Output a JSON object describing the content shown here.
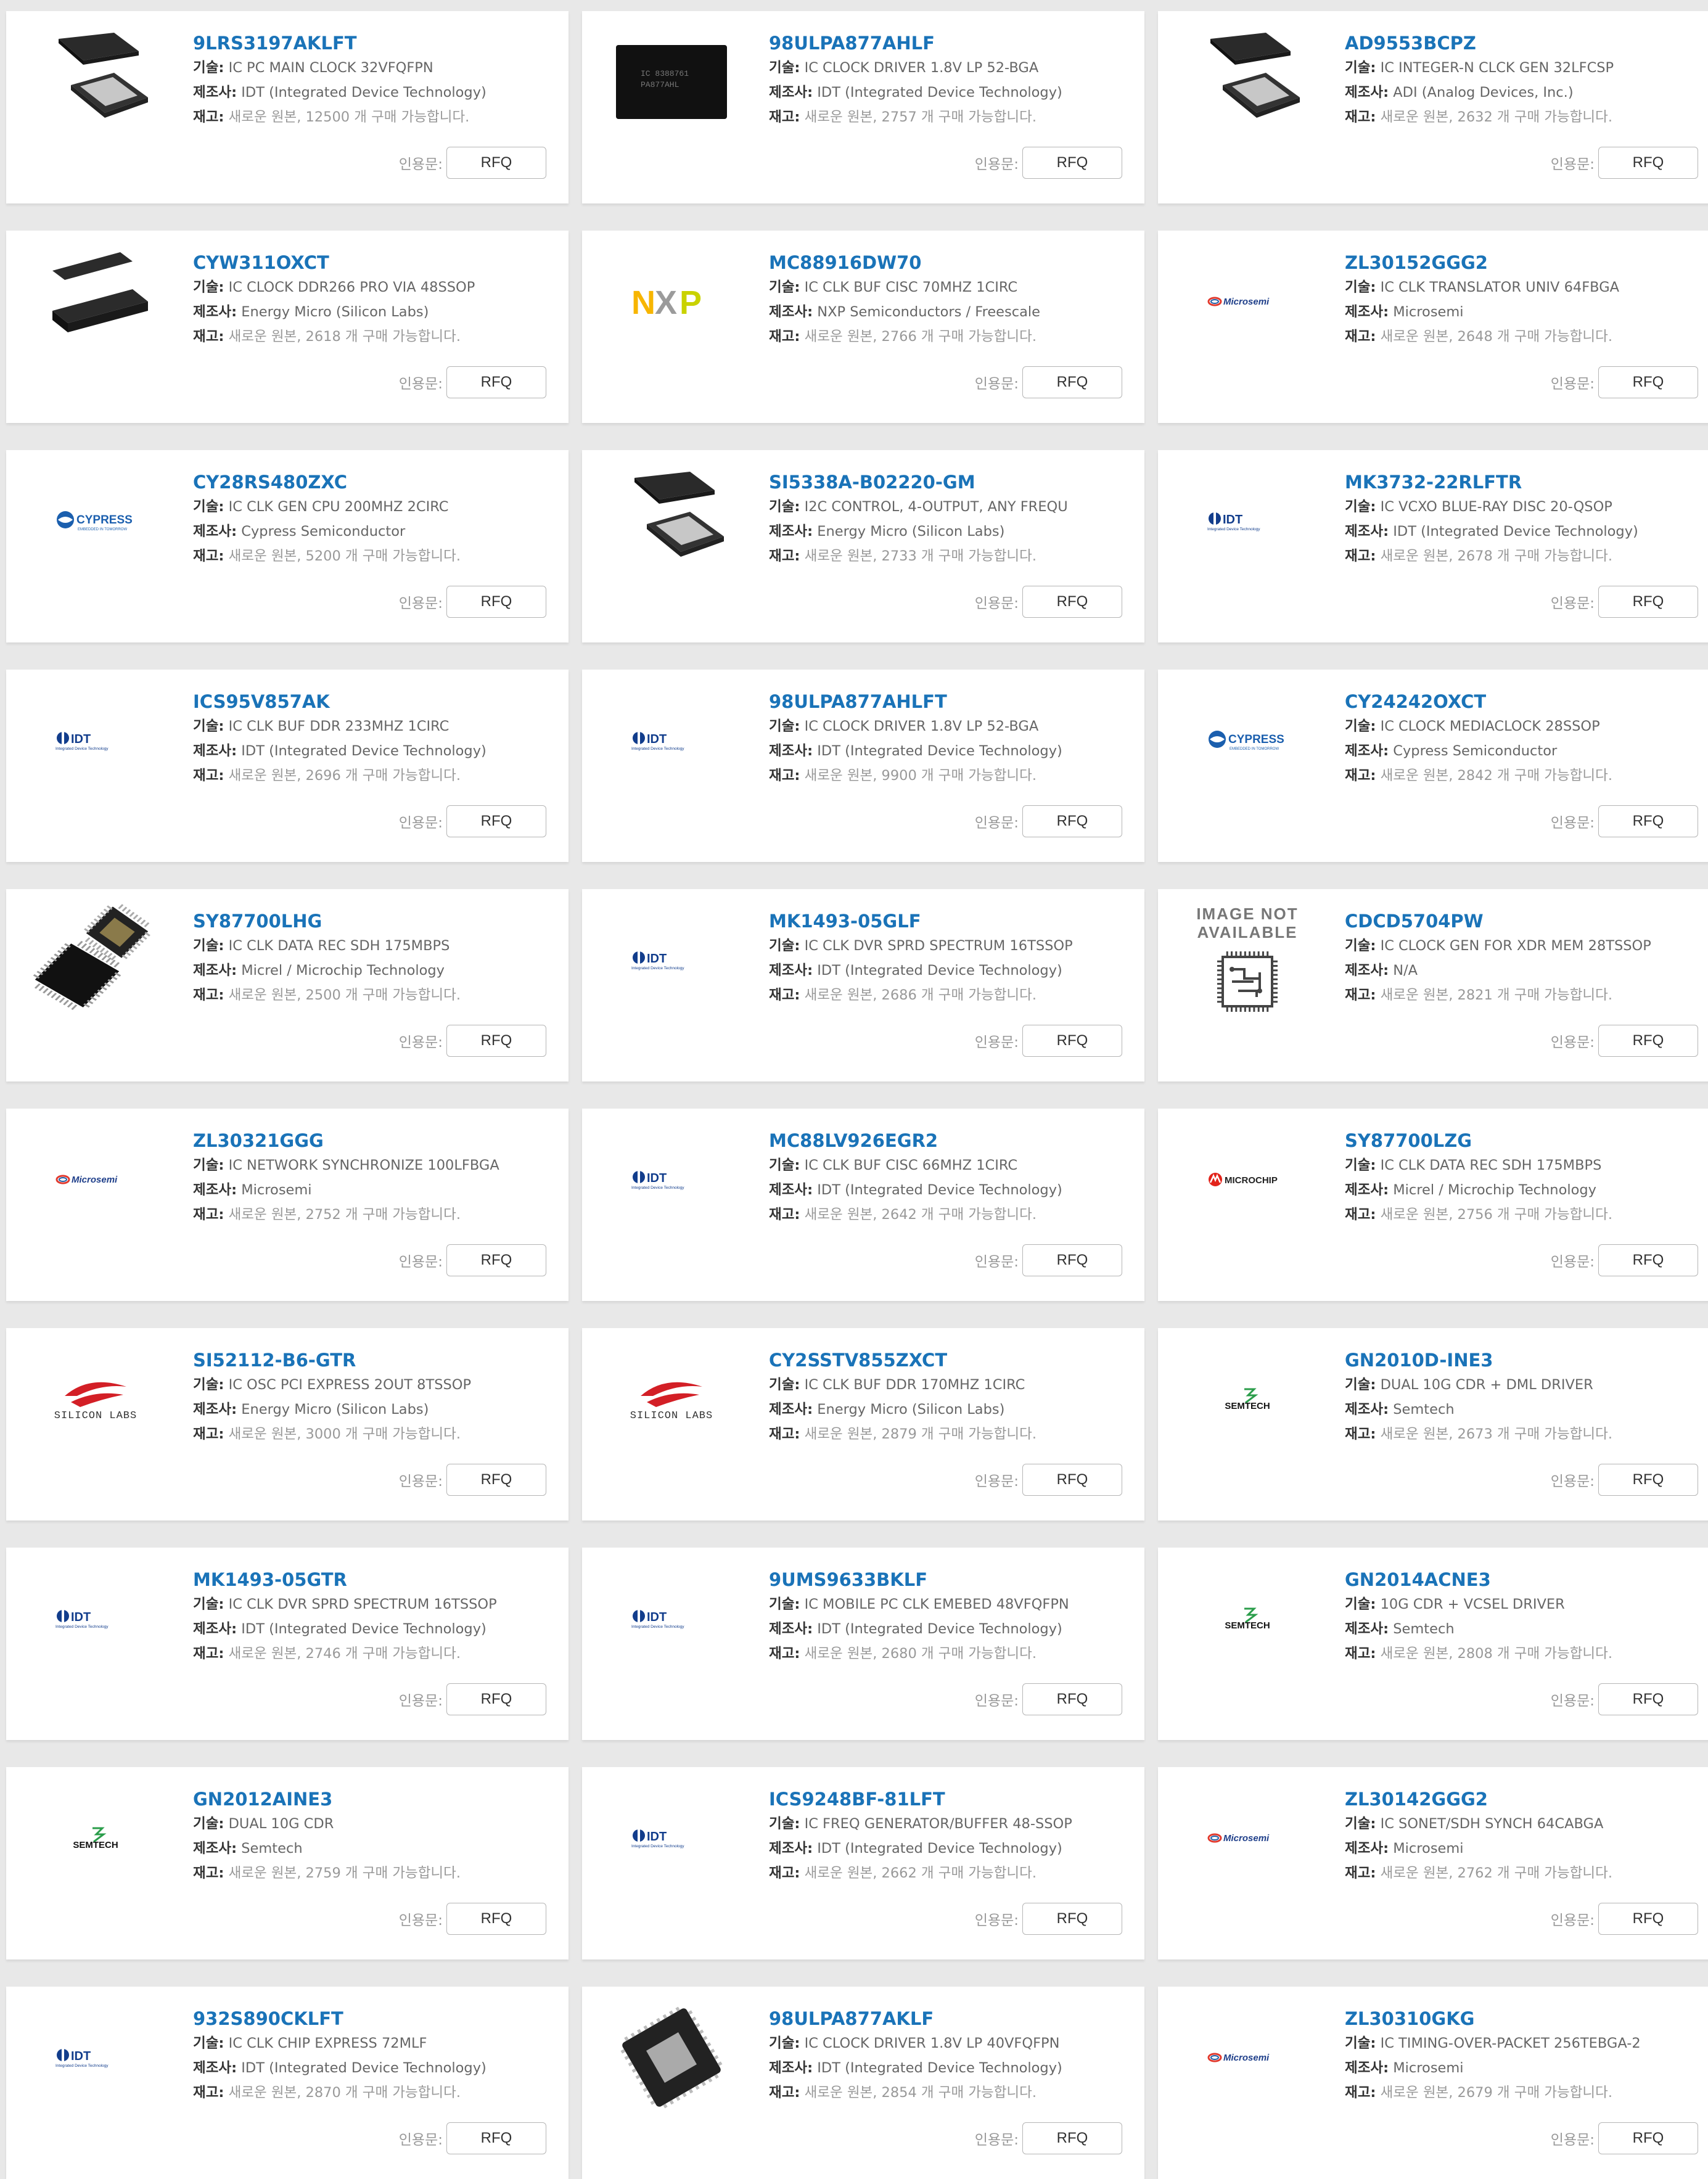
{
  "labels": {
    "tech": "기술:",
    "mfr": "제조사:",
    "stock": "재고:",
    "quote": "인용문:",
    "rfq": "RFQ",
    "image_not_available": "IMAGE NOT AVAILABLE"
  },
  "products": [
    {
      "pn": "9LRS3197AKLFT",
      "tech": "IC PC MAIN CLOCK 32VFQFPN",
      "mfr": "IDT (Integrated Device Technology)",
      "stock": "새로운 원본, 12500 개 구매 가능합니다.",
      "image": "qfn-chip"
    },
    {
      "pn": "98ULPA877AHLF",
      "tech": "IC CLOCK DRIVER 1.8V LP 52-BGA",
      "mfr": "IDT (Integrated Device Technology)",
      "stock": "새로운 원본, 2757 개 구매 가능합니다.",
      "image": "bga-chip"
    },
    {
      "pn": "AD9553BCPZ",
      "tech": "IC INTEGER-N CLCK GEN 32LFCSP",
      "mfr": "ADI (Analog Devices, Inc.)",
      "stock": "새로운 원본, 2632 개 구매 가능합니다.",
      "image": "qfn-chip"
    },
    {
      "pn": "CYW311OXCT",
      "tech": "IC CLOCK DDR266 PRO VIA 48SSOP",
      "mfr": "Energy Micro (Silicon Labs)",
      "stock": "새로운 원본, 2618 개 구매 가능합니다.",
      "image": "ssop-chip"
    },
    {
      "pn": "MC88916DW70",
      "tech": "IC CLK BUF CISC 70MHZ 1CIRC",
      "mfr": "NXP Semiconductors / Freescale",
      "stock": "새로운 원본, 2766 개 구매 가능합니다.",
      "image": "nxp-logo"
    },
    {
      "pn": "ZL30152GGG2",
      "tech": "IC CLK TRANSLATOR UNIV 64FBGA",
      "mfr": "Microsemi",
      "stock": "새로운 원본, 2648 개 구매 가능합니다.",
      "image": "microsemi-logo"
    },
    {
      "pn": "CY28RS480ZXC",
      "tech": "IC CLK GEN CPU 200MHZ 2CIRC",
      "mfr": "Cypress Semiconductor",
      "stock": "새로운 원본, 5200 개 구매 가능합니다.",
      "image": "cypress-logo"
    },
    {
      "pn": "SI5338A-B02220-GM",
      "tech": "I2C CONTROL, 4-OUTPUT, ANY FREQU",
      "mfr": "Energy Micro (Silicon Labs)",
      "stock": "새로운 원본, 2733 개 구매 가능합니다.",
      "image": "qfn-chip"
    },
    {
      "pn": "MK3732-22RLFTR",
      "tech": "IC VCXO BLUE-RAY DISC 20-QSOP",
      "mfr": "IDT (Integrated Device Technology)",
      "stock": "새로운 원본, 2678 개 구매 가능합니다.",
      "image": "idt-logo"
    },
    {
      "pn": "ICS95V857AK",
      "tech": "IC CLK BUF DDR 233MHZ 1CIRC",
      "mfr": "IDT (Integrated Device Technology)",
      "stock": "새로운 원본, 2696 개 구매 가능합니다.",
      "image": "idt-logo"
    },
    {
      "pn": "98ULPA877AHLFT",
      "tech": "IC CLOCK DRIVER 1.8V LP 52-BGA",
      "mfr": "IDT (Integrated Device Technology)",
      "stock": "새로운 원본, 9900 개 구매 가능합니다.",
      "image": "idt-logo"
    },
    {
      "pn": "CY24242OXCT",
      "tech": "IC CLOCK MEDIACLOCK 28SSOP",
      "mfr": "Cypress Semiconductor",
      "stock": "새로운 원본, 2842 개 구매 가능합니다.",
      "image": "cypress-logo"
    },
    {
      "pn": "SY87700LHG",
      "tech": "IC CLK DATA REC SDH 175MBPS",
      "mfr": "Micrel / Microchip Technology",
      "stock": "새로운 원본, 2500 개 구매 가능합니다.",
      "image": "tqfp-chip"
    },
    {
      "pn": "MK1493-05GLF",
      "tech": "IC CLK DVR SPRD SPECTRUM 16TSSOP",
      "mfr": "IDT (Integrated Device Technology)",
      "stock": "새로운 원본, 2686 개 구매 가능합니다.",
      "image": "idt-logo"
    },
    {
      "pn": "CDCD5704PW",
      "tech": "IC CLOCK GEN FOR XDR MEM 28TSSOP",
      "mfr": "N/A",
      "stock": "새로운 원본, 2821 개 구매 가능합니다.",
      "image": "not-available"
    },
    {
      "pn": "ZL30321GGG",
      "tech": "IC NETWORK SYNCHRONIZE 100LFBGA",
      "mfr": "Microsemi",
      "stock": "새로운 원본, 2752 개 구매 가능합니다.",
      "image": "microsemi-logo"
    },
    {
      "pn": "MC88LV926EGR2",
      "tech": "IC CLK BUF CISC 66MHZ 1CIRC",
      "mfr": "IDT (Integrated Device Technology)",
      "stock": "새로운 원본, 2642 개 구매 가능합니다.",
      "image": "idt-logo"
    },
    {
      "pn": "SY87700LZG",
      "tech": "IC CLK DATA REC SDH 175MBPS",
      "mfr": "Micrel / Microchip Technology",
      "stock": "새로운 원본, 2756 개 구매 가능합니다.",
      "image": "microchip-logo"
    },
    {
      "pn": "SI52112-B6-GTR",
      "tech": "IC OSC PCI EXPRESS 2OUT 8TSSOP",
      "mfr": "Energy Micro (Silicon Labs)",
      "stock": "새로운 원본, 3000 개 구매 가능합니다.",
      "image": "silabs-logo"
    },
    {
      "pn": "CY2SSTV855ZXCT",
      "tech": "IC CLK BUF DDR 170MHZ 1CIRC",
      "mfr": "Energy Micro (Silicon Labs)",
      "stock": "새로운 원본, 2879 개 구매 가능합니다.",
      "image": "silabs-logo"
    },
    {
      "pn": "GN2010D-INE3",
      "tech": "DUAL 10G CDR + DML DRIVER",
      "mfr": "Semtech",
      "stock": "새로운 원본, 2673 개 구매 가능합니다.",
      "image": "semtech-logo"
    },
    {
      "pn": "MK1493-05GTR",
      "tech": "IC CLK DVR SPRD SPECTRUM 16TSSOP",
      "mfr": "IDT (Integrated Device Technology)",
      "stock": "새로운 원본, 2746 개 구매 가능합니다.",
      "image": "idt-logo"
    },
    {
      "pn": "9UMS9633BKLF",
      "tech": "IC MOBILE PC CLK EMEBED 48VFQFPN",
      "mfr": "IDT (Integrated Device Technology)",
      "stock": "새로운 원본, 2680 개 구매 가능합니다.",
      "image": "idt-logo"
    },
    {
      "pn": "GN2014ACNE3",
      "tech": "10G CDR + VCSEL DRIVER",
      "mfr": "Semtech",
      "stock": "새로운 원본, 2808 개 구매 가능합니다.",
      "image": "semtech-logo"
    },
    {
      "pn": "GN2012AINE3",
      "tech": "DUAL 10G CDR",
      "mfr": "Semtech",
      "stock": "새로운 원본, 2759 개 구매 가능합니다.",
      "image": "semtech-logo"
    },
    {
      "pn": "ICS9248BF-81LFT",
      "tech": "IC FREQ GENERATOR/BUFFER 48-SSOP",
      "mfr": "IDT (Integrated Device Technology)",
      "stock": "새로운 원본, 2662 개 구매 가능합니다.",
      "image": "idt-logo"
    },
    {
      "pn": "ZL30142GGG2",
      "tech": "IC SONET/SDH SYNCH 64CABGA",
      "mfr": "Microsemi",
      "stock": "새로운 원본, 2762 개 구매 가능합니다.",
      "image": "microsemi-logo"
    },
    {
      "pn": "932S890CKLFT",
      "tech": "IC CLK CHIP EXPRESS 72MLF",
      "mfr": "IDT (Integrated Device Technology)",
      "stock": "새로운 원본, 2870 개 구매 가능합니다.",
      "image": "idt-logo"
    },
    {
      "pn": "98ULPA877AKLF",
      "tech": "IC CLOCK DRIVER 1.8V LP 40VFQFPN",
      "mfr": "IDT (Integrated Device Technology)",
      "stock": "새로운 원본, 2854 개 구매 가능합니다.",
      "image": "qfn-tilted"
    },
    {
      "pn": "ZL30310GKG",
      "tech": "IC TIMING-OVER-PACKET 256TEBGA-2",
      "mfr": "Microsemi",
      "stock": "새로운 원본, 2679 개 구매 가능합니다.",
      "image": "microsemi-logo"
    }
  ],
  "colors": {
    "part_number": "#1a73b8",
    "background": "#e8e8e8",
    "card": "#ffffff",
    "stock_text": "#999999"
  }
}
